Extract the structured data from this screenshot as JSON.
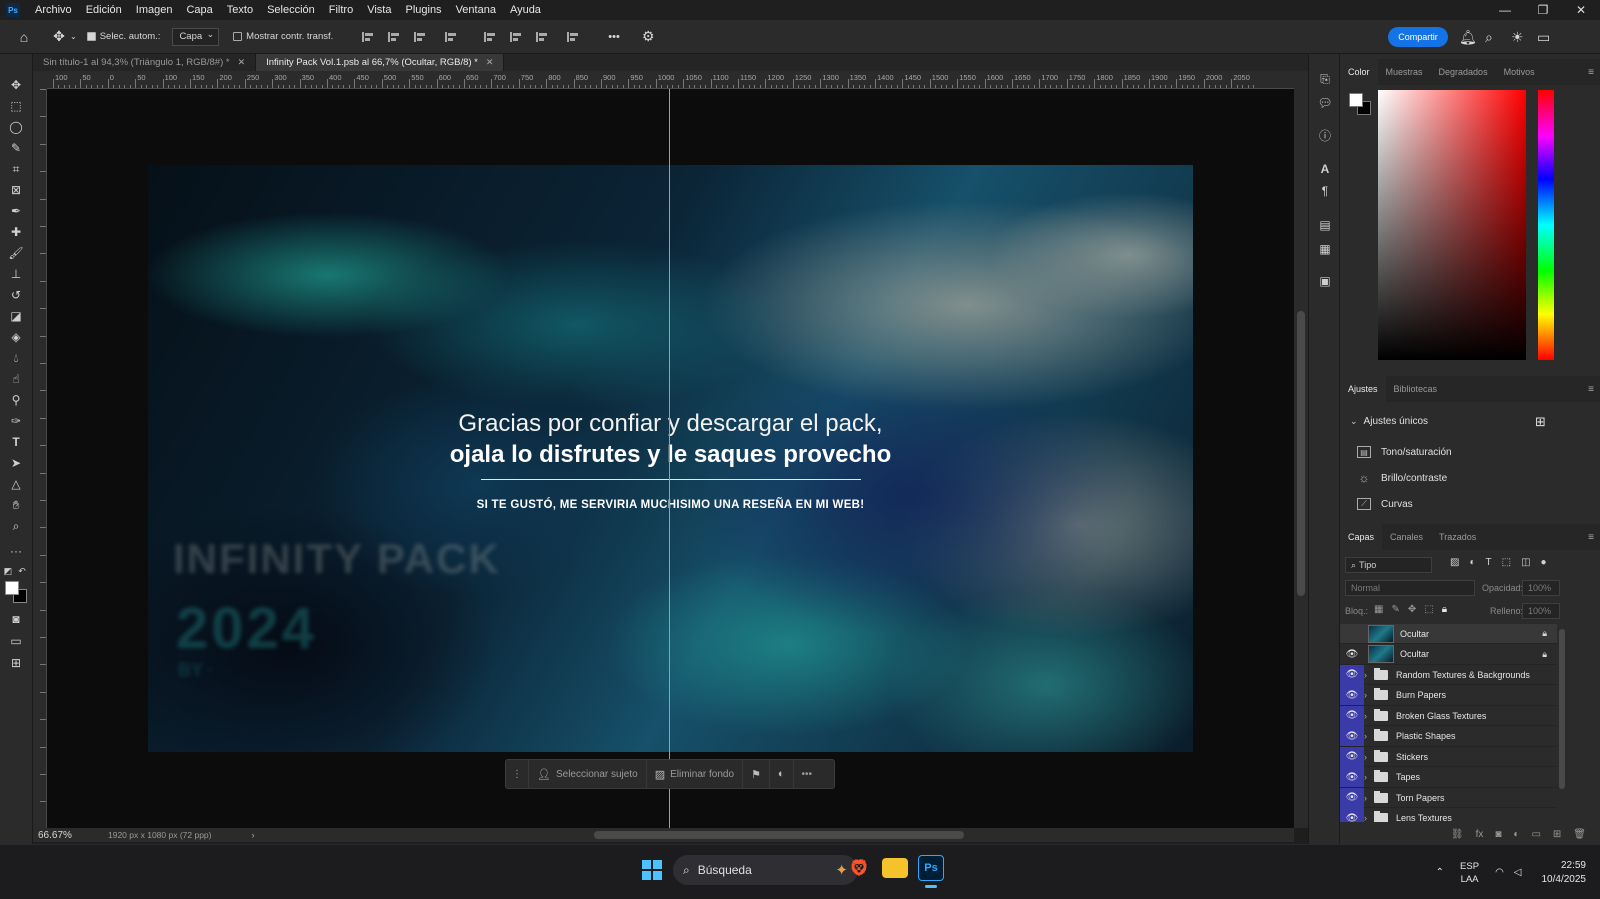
{
  "menubar": {
    "logo": "Ps",
    "items": [
      "Archivo",
      "Edición",
      "Imagen",
      "Capa",
      "Texto",
      "Selección",
      "Filtro",
      "Vista",
      "Plugins",
      "Ventana",
      "Ayuda"
    ],
    "window_controls": [
      "—",
      "❐",
      "✕"
    ]
  },
  "options_bar": {
    "auto_select_label": "Selec. autom.:",
    "auto_select_checked": true,
    "auto_select_target": "Capa",
    "show_transform_label": "Mostrar contr. transf.",
    "show_transform_checked": false,
    "more_label": "•••",
    "share_label": "Compartir"
  },
  "tabs": [
    {
      "label": "Sin título-1 al 94,3% (Triángulo 1, RGB/8#) *",
      "active": false
    },
    {
      "label": "Infinity Pack Vol.1.psb al 66,7% (Ocultar, RGB/8) *",
      "active": true
    }
  ],
  "ruler": {
    "labels": [
      "100",
      "50",
      "0",
      "50",
      "100",
      "150",
      "200",
      "250",
      "300",
      "350",
      "400",
      "450",
      "500",
      "550",
      "600",
      "650",
      "700",
      "750",
      "800",
      "850",
      "900",
      "950",
      "1000",
      "1050",
      "1100",
      "1150",
      "1200",
      "1250",
      "1300",
      "1350",
      "1400",
      "1450",
      "1500",
      "1550",
      "1600",
      "1650",
      "1700",
      "1750",
      "1800",
      "1850",
      "1900",
      "1950",
      "2000",
      "2050"
    ]
  },
  "artboard": {
    "line1": "Gracias por confiar y descargar el pack,",
    "line2": "ojala lo disfrutes y le saques provecho",
    "line3": "SI TE GUSTÓ, ME SERVIRIA MUCHISIMO UNA RESEÑA EN MI WEB!",
    "logo_title": "INFINITY PACK",
    "logo_year": "2024",
    "logo_small": "BY ·"
  },
  "context_bar": {
    "select_subject": "Seleccionar sujeto",
    "remove_bg": "Eliminar fondo",
    "more": "•••"
  },
  "status": {
    "zoom": "66.67%",
    "doc_info": "1920 px x 1080 px (72 ppp)"
  },
  "color_panel": {
    "tabs": [
      "Color",
      "Muestras",
      "Degradados",
      "Motivos"
    ],
    "active_tab": "Color"
  },
  "adjustments_panel": {
    "tabs": [
      "Ajustes",
      "Bibliotecas"
    ],
    "section": "Ajustes únicos",
    "items": [
      "Tono/saturación",
      "Brillo/contraste",
      "Curvas"
    ]
  },
  "layers_panel": {
    "tabs": [
      "Capas",
      "Canales",
      "Trazados"
    ],
    "filter_label": "Tipo",
    "blend_mode": "Normal",
    "opacity_label": "Opacidad:",
    "opacity_value": "100%",
    "lock_label": "Bloq.:",
    "fill_label": "Relleno:",
    "fill_value": "100%",
    "layers": [
      {
        "name": "Ocultar",
        "type": "smart",
        "visible": false,
        "selected": true,
        "locked": true
      },
      {
        "name": "Ocultar",
        "type": "smart",
        "visible": true,
        "selected": false,
        "locked": true
      },
      {
        "name": "Random Textures & Backgrounds",
        "type": "group",
        "visible": true
      },
      {
        "name": "Burn Papers",
        "type": "group",
        "visible": true
      },
      {
        "name": "Broken Glass Textures",
        "type": "group",
        "visible": true
      },
      {
        "name": "Plastic Shapes",
        "type": "group",
        "visible": true
      },
      {
        "name": "Stickers",
        "type": "group",
        "visible": true
      },
      {
        "name": "Tapes",
        "type": "group",
        "visible": true
      },
      {
        "name": "Torn Papers",
        "type": "group",
        "visible": true
      },
      {
        "name": "Lens Textures",
        "type": "group",
        "visible": true
      }
    ]
  },
  "taskbar": {
    "search_placeholder": "Búsqueda",
    "ps_app": "Ps",
    "lang_top": "ESP",
    "lang_bottom": "LAA",
    "time": "22:59",
    "date": "10/4/2025"
  },
  "colors": {
    "accent": "#1473e6",
    "guide": "#3cc6d0",
    "layer_eye_bg": "#3a3aa8"
  }
}
